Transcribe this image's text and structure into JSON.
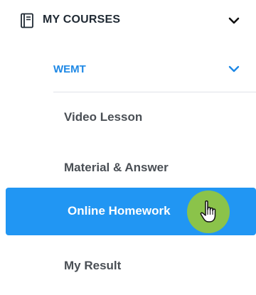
{
  "sidebar": {
    "section": {
      "title": "MY COURSES",
      "icon": "book-icon",
      "toggle_icon": "chevron-down-icon"
    },
    "course": {
      "title": "WEMT",
      "toggle_icon": "chevron-down-icon",
      "accent_color": "#1e88e5"
    },
    "items": [
      {
        "label": "Video Lesson"
      },
      {
        "label": "Material & Answer"
      },
      {
        "label": "Online Homework",
        "active": true
      },
      {
        "label": "My Result"
      }
    ],
    "active_color": "#2196f3",
    "cursor": {
      "icon": "hand-pointer-icon",
      "highlight_color": "#8bc34a"
    }
  }
}
